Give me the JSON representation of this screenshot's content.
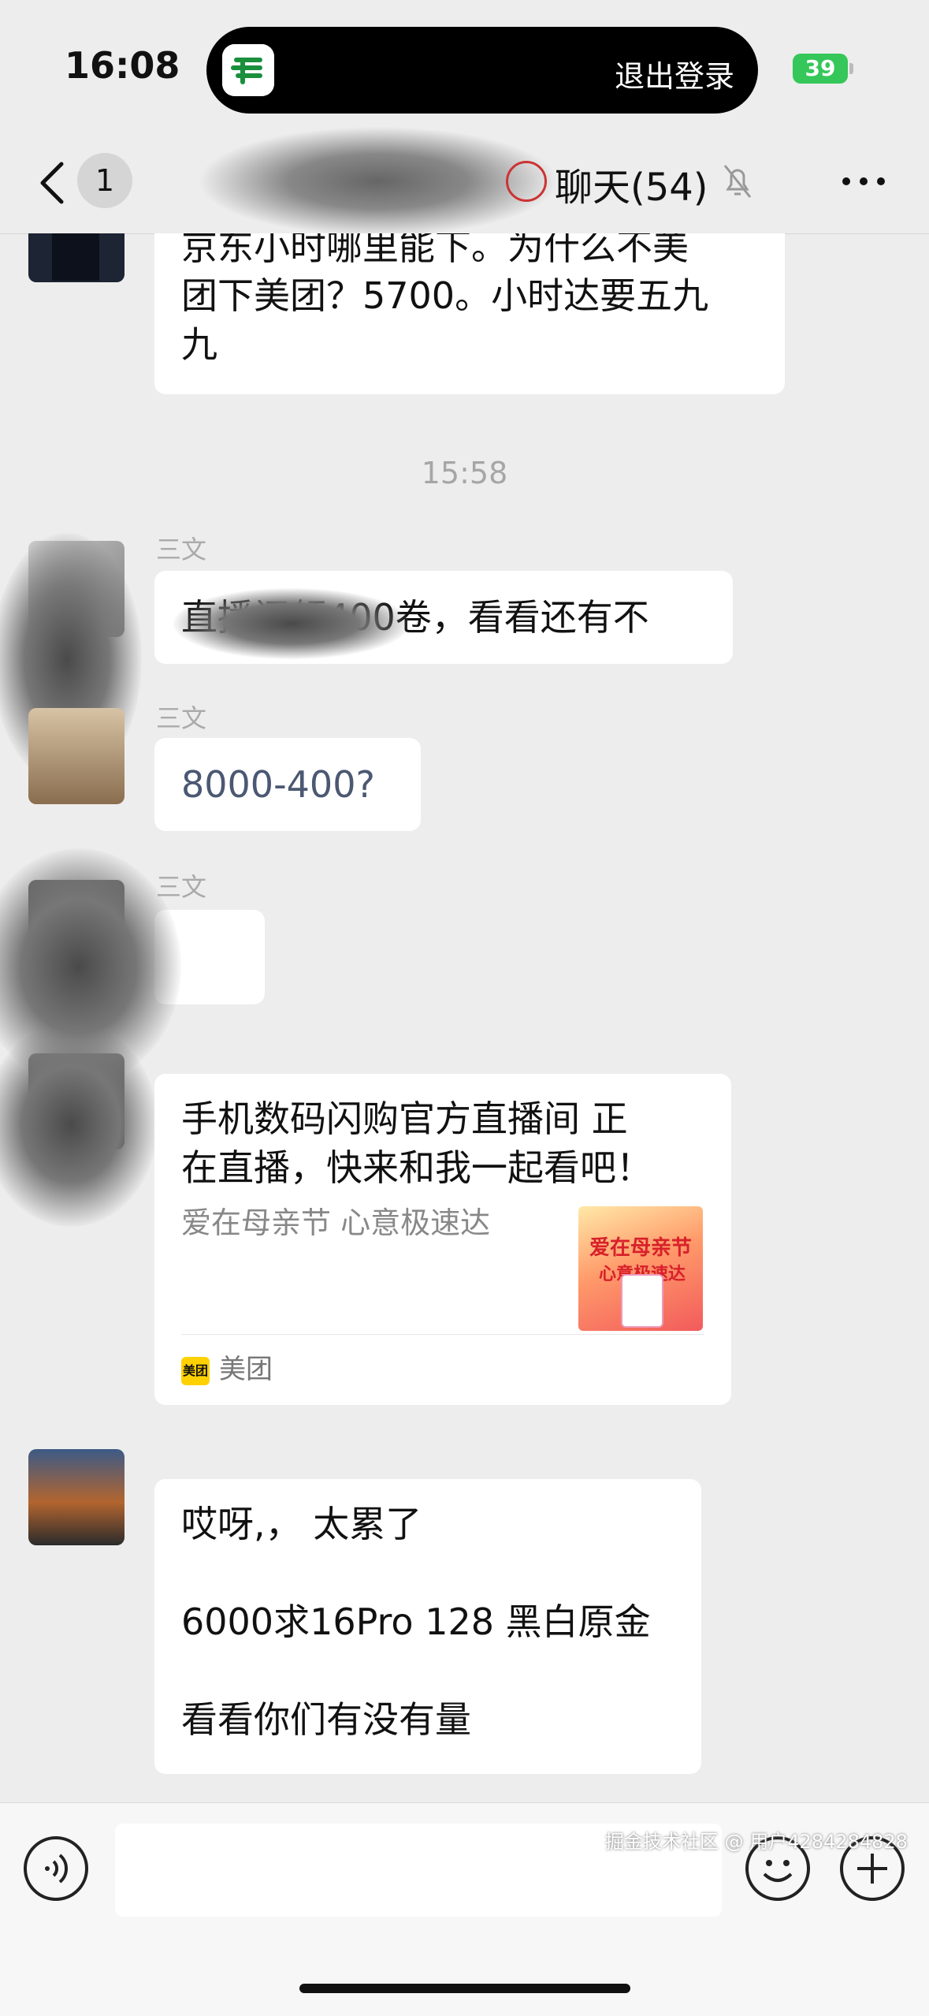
{
  "status_bar": {
    "time": "16:08",
    "island_action": "退出登录",
    "battery": "39"
  },
  "nav": {
    "unread_count": "1",
    "title": "聊天(54)"
  },
  "messages": [
    {
      "type": "text",
      "text_line1": "京东小时哪里能下。为什么不美",
      "text_line2": "团下美团？5700。小时达要五九",
      "text_line3": "九"
    },
    {
      "type": "timestamp",
      "text": "15:58"
    },
    {
      "type": "text",
      "sender": "三文",
      "text": "直播间领400卷，看看还有不"
    },
    {
      "type": "text",
      "sender": "三文",
      "text": "8000-400?"
    },
    {
      "type": "text",
      "sender": "三文",
      "text": ""
    },
    {
      "type": "card",
      "title_line1": "手机数码闪购官方直播间 正",
      "title_line2": "在直播，快来和我一起看吧！",
      "subtitle": "爱在母亲节 心意极速达",
      "thumb_line1": "爱在母亲节",
      "thumb_line2": "心意极速达",
      "source": "美团",
      "source_logo": "美团"
    },
    {
      "type": "text",
      "line1": "哎呀,，  太累了",
      "line2": "6000求16Pro 128 黑白原金",
      "line3": "看看你们有没有量"
    }
  ],
  "watermark": "掘金技术社区 @ 用户4284284828",
  "colors": {
    "background": "#ededed",
    "bubble": "#ffffff",
    "battery": "#35c759",
    "meituan_yellow": "#ffd100"
  },
  "icons": [
    "back-chevron-icon",
    "mute-bell-icon",
    "more-dots-icon",
    "voice-icon",
    "emoji-icon",
    "plus-icon",
    "post-office-logo-icon"
  ]
}
